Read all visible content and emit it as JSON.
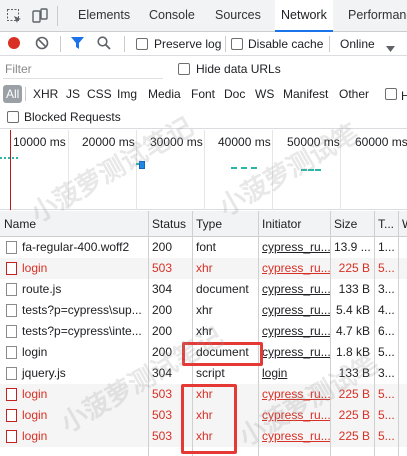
{
  "tabs": {
    "elements": "Elements",
    "console": "Console",
    "sources": "Sources",
    "network": "Network",
    "performance": "Performanc"
  },
  "toolbar": {
    "preserve_log": "Preserve log",
    "disable_cache": "Disable cache",
    "throttle": "Online"
  },
  "filter": {
    "placeholder": "Filter",
    "hide_data_urls": "Hide data URLs"
  },
  "types": [
    "All",
    "XHR",
    "JS",
    "CSS",
    "Img",
    "Media",
    "Font",
    "Doc",
    "WS",
    "Manifest",
    "Other"
  ],
  "blocked_requests": "Blocked Requests",
  "overview": {
    "ticks": [
      "10000 ms",
      "20000 ms",
      "30000 ms",
      "40000 ms",
      "50000 ms",
      "60000 ms"
    ]
  },
  "columns": [
    "Name",
    "Status",
    "Type",
    "Initiator",
    "Size",
    "T...",
    "W"
  ],
  "rows": [
    {
      "name": "fa-regular-400.woff2",
      "status": "200",
      "type": "font",
      "initiator": "cypress_ru...",
      "size": "13.9 ...",
      "time": "1...",
      "error": false
    },
    {
      "name": "login",
      "status": "503",
      "type": "xhr",
      "initiator": "cypress_ru...",
      "size": "225 B",
      "time": "5...",
      "error": true
    },
    {
      "name": "route.js",
      "status": "304",
      "type": "document",
      "initiator": "cypress_ru...",
      "size": "133 B",
      "time": "3...",
      "error": false
    },
    {
      "name": "tests?p=cypress\\sup...",
      "status": "200",
      "type": "xhr",
      "initiator": "cypress_ru...",
      "size": "5.4 kB",
      "time": "4...",
      "error": false
    },
    {
      "name": "tests?p=cypress\\inte...",
      "status": "200",
      "type": "xhr",
      "initiator": "cypress_ru...",
      "size": "4.7 kB",
      "time": "6...",
      "error": false
    },
    {
      "name": "login",
      "status": "200",
      "type": "document",
      "initiator": "cypress_ru...",
      "size": "1.8 kB",
      "time": "5...",
      "error": false
    },
    {
      "name": "jquery.js",
      "status": "304",
      "type": "script",
      "initiator": "login",
      "size": "133 B",
      "time": "3...",
      "error": false
    },
    {
      "name": "login",
      "status": "503",
      "type": "xhr",
      "initiator": "cypress_ru...",
      "size": "225 B",
      "time": "5...",
      "error": true
    },
    {
      "name": "login",
      "status": "503",
      "type": "xhr",
      "initiator": "cypress_ru...",
      "size": "225 B",
      "time": "5...",
      "error": true
    },
    {
      "name": "login",
      "status": "503",
      "type": "xhr",
      "initiator": "cypress_ru...",
      "size": "225 B",
      "time": "5...",
      "error": true
    }
  ],
  "colors": {
    "error": "#d93025",
    "accent": "#1a73e8",
    "annotation": "#e53935"
  }
}
